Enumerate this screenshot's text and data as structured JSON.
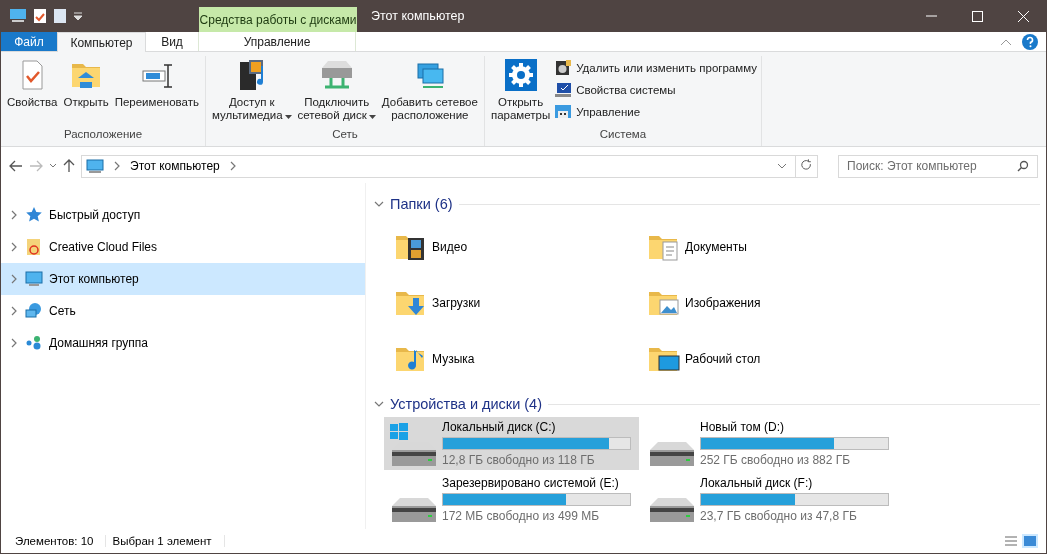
{
  "title_bar": {
    "context_group": "Средства работы с дисками",
    "title": "Этот компьютер"
  },
  "ribbon_tabs": [
    {
      "label": "Файл",
      "kind": "file",
      "selected": false
    },
    {
      "label": "Компьютер",
      "kind": "tab",
      "selected": true
    },
    {
      "label": "Вид",
      "kind": "tab",
      "selected": false
    },
    {
      "label": "Управление",
      "kind": "context",
      "selected": false
    }
  ],
  "ribbon_groups": [
    {
      "label": "Расположение",
      "buttons": [
        {
          "kind": "large",
          "lines": [
            "Свойства"
          ],
          "dropdown": false
        },
        {
          "kind": "large",
          "lines": [
            "Открыть"
          ],
          "dropdown": false
        },
        {
          "kind": "large",
          "lines": [
            "Переименовать"
          ],
          "dropdown": false
        }
      ]
    },
    {
      "label": "Сеть",
      "buttons": [
        {
          "kind": "large",
          "lines": [
            "Доступ к",
            "мультимедиа"
          ],
          "dropdown": true
        },
        {
          "kind": "large",
          "lines": [
            "Подключить",
            "сетевой диск"
          ],
          "dropdown": true
        },
        {
          "kind": "large",
          "lines": [
            "Добавить сетевое",
            "расположение"
          ],
          "dropdown": false
        }
      ]
    },
    {
      "label": "Система",
      "buttons": [
        {
          "kind": "large",
          "lines": [
            "Открыть",
            "параметры"
          ],
          "dropdown": false
        },
        {
          "kind": "small",
          "lines": [
            "Удалить или изменить программу"
          ]
        },
        {
          "kind": "small",
          "lines": [
            "Свойства системы"
          ]
        },
        {
          "kind": "small",
          "lines": [
            "Управление"
          ]
        }
      ]
    }
  ],
  "address_bar": {
    "crumbs": [
      "Этот компьютер"
    ]
  },
  "search": {
    "placeholder": "Поиск: Этот компьютер"
  },
  "nav_pane": [
    {
      "label": "Быстрый доступ",
      "selected": false,
      "expanded": false
    },
    {
      "label": "Creative Cloud Files",
      "selected": false,
      "expanded": false
    },
    {
      "label": "Этот компьютер",
      "selected": true,
      "expanded": false
    },
    {
      "label": "Сеть",
      "selected": false,
      "expanded": false
    },
    {
      "label": "Домашняя группа",
      "selected": false,
      "expanded": false
    }
  ],
  "sections": [
    {
      "title": "Папки (6)",
      "kind": "folders",
      "expanded": true,
      "items": [
        {
          "label": "Видео"
        },
        {
          "label": "Документы"
        },
        {
          "label": "Загрузки"
        },
        {
          "label": "Изображения"
        },
        {
          "label": "Музыка"
        },
        {
          "label": "Рабочий стол"
        }
      ]
    },
    {
      "title": "Устройства и диски (4)",
      "kind": "drives",
      "expanded": true,
      "items": [
        {
          "label": "Локальный диск (C:)",
          "info": "12,8 ГБ свободно из 118 ГБ",
          "level": 0.89,
          "system": true,
          "selected": true
        },
        {
          "label": "Новый том (D:)",
          "info": "252 ГБ свободно из 882 ГБ",
          "level": 0.71,
          "system": false,
          "selected": false
        },
        {
          "label": "Зарезервировано системой (E:)",
          "info": "172 МБ свободно из 499 МБ",
          "level": 0.66,
          "system": false,
          "selected": false
        },
        {
          "label": "Локальный диск (F:)",
          "info": "23,7 ГБ свободно из 47,8 ГБ",
          "level": 0.5,
          "system": false,
          "selected": false
        }
      ]
    }
  ],
  "status_bar": [
    "Элементов: 10",
    "Выбран 1 элемент"
  ]
}
